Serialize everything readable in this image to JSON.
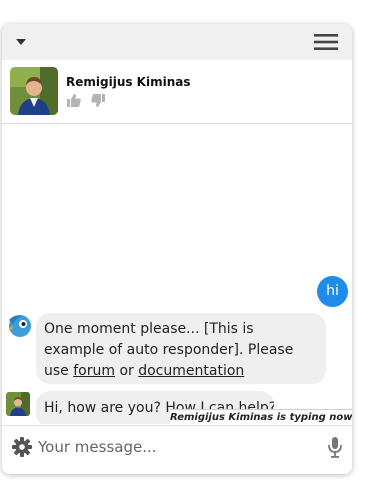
{
  "agent": {
    "name": "Remigijus Kiminas",
    "like_icon": "thumbs-up-icon",
    "dislike_icon": "thumbs-down-icon"
  },
  "header": {
    "collapse_icon": "chevron-down-icon",
    "menu_icon": "hamburger-menu-icon"
  },
  "messages": [
    {
      "from": "visitor",
      "text": "hi"
    },
    {
      "from": "bot",
      "text_before_forum": "One moment please... [This is example of auto responder]. Please use ",
      "forum_link": "forum",
      "text_between": " or ",
      "documentation_link": "documentation"
    },
    {
      "from": "agent",
      "text": "Hi, how are you? How I can help?"
    }
  ],
  "typing_status": "Remigijus Kiminas is typing now...",
  "composer": {
    "placeholder": "Your message...",
    "settings_icon": "gear-icon",
    "mic_icon": "microphone-icon"
  },
  "colors": {
    "visitor_bubble": "#1f8ceb",
    "bubble_bg": "#efefef",
    "topbar_bg": "#f0f0f0"
  }
}
